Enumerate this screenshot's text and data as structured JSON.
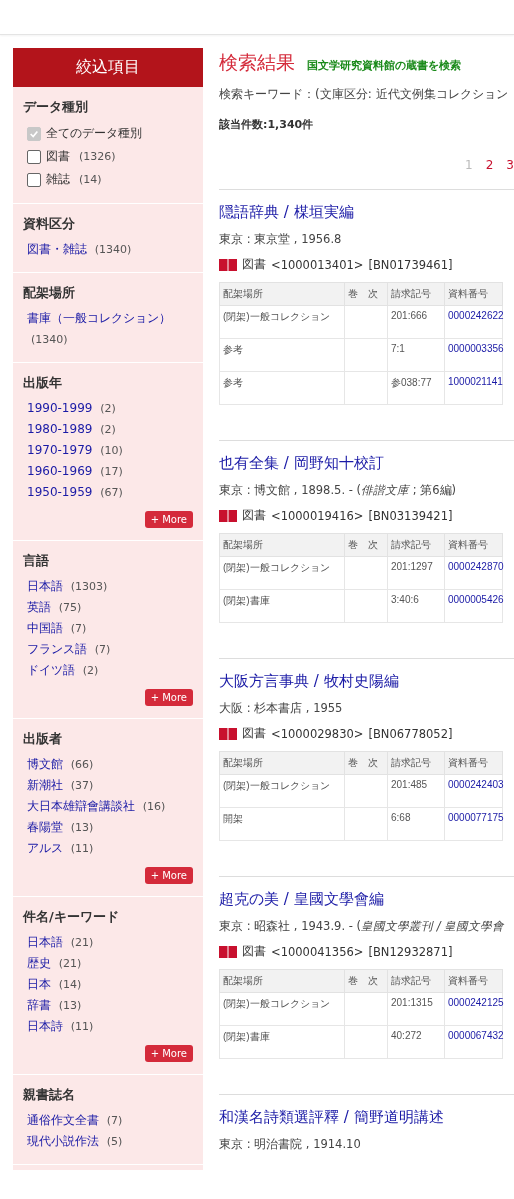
{
  "sidebar": {
    "title": "絞込項目",
    "sections": [
      {
        "kind": "checkboxes",
        "heading": "データ種別",
        "items": [
          {
            "label": "全てのデータ種別",
            "checked": true,
            "disabled": true
          },
          {
            "label": "図書",
            "count": "(1326)",
            "checked": false,
            "disabled": false
          },
          {
            "label": "雑誌",
            "count": "(14)",
            "checked": false,
            "disabled": false
          }
        ]
      },
      {
        "kind": "links",
        "heading": "資料区分",
        "items": [
          {
            "label": "図書・雑誌",
            "count": "(1340)"
          }
        ]
      },
      {
        "kind": "links",
        "heading": "配架場所",
        "items": [
          {
            "label": "書庫（一般コレクション）",
            "count": "(1340)"
          }
        ]
      },
      {
        "kind": "links",
        "heading": "出版年",
        "items": [
          {
            "label": "1990-1999",
            "count": "(2)"
          },
          {
            "label": "1980-1989",
            "count": "(2)"
          },
          {
            "label": "1970-1979",
            "count": "(10)"
          },
          {
            "label": "1960-1969",
            "count": "(17)"
          },
          {
            "label": "1950-1959",
            "count": "(67)"
          }
        ],
        "more": "+ More"
      },
      {
        "kind": "links",
        "heading": "言語",
        "items": [
          {
            "label": "日本語",
            "count": "(1303)"
          },
          {
            "label": "英語",
            "count": "(75)"
          },
          {
            "label": "中国語",
            "count": "(7)"
          },
          {
            "label": "フランス語",
            "count": "(7)"
          },
          {
            "label": "ドイツ語",
            "count": "(2)"
          }
        ],
        "more": "+ More"
      },
      {
        "kind": "links",
        "heading": "出版者",
        "items": [
          {
            "label": "博文館",
            "count": "(66)"
          },
          {
            "label": "新潮社",
            "count": "(37)"
          },
          {
            "label": "大日本雄辯會講談社",
            "count": "(16)"
          },
          {
            "label": "春陽堂",
            "count": "(13)"
          },
          {
            "label": "アルス",
            "count": "(11)"
          }
        ],
        "more": "+ More"
      },
      {
        "kind": "links",
        "heading": "件名/キーワード",
        "items": [
          {
            "label": "日本語",
            "count": "(21)"
          },
          {
            "label": "歴史",
            "count": "(21)"
          },
          {
            "label": "日本",
            "count": "(14)"
          },
          {
            "label": "辞書",
            "count": "(13)"
          },
          {
            "label": "日本詩",
            "count": "(11)"
          }
        ],
        "more": "+ More"
      },
      {
        "kind": "links",
        "heading": "親書誌名",
        "items": [
          {
            "label": "通俗作文全書",
            "count": "(7)"
          },
          {
            "label": "現代小説作法",
            "count": "(5)"
          }
        ]
      }
    ]
  },
  "main": {
    "title": "検索結果",
    "subtitle": "国文学研究資料館の蔵書を検索",
    "keyword": "検索キーワード：(文庫区分: 近代文例集コレクション",
    "hits": "該当件数:1,340件",
    "pages": [
      {
        "label": "1",
        "selected": true
      },
      {
        "label": "2",
        "selected": false
      },
      {
        "label": "3",
        "selected": false
      }
    ],
    "records": [
      {
        "title": "隠語辞典 / 楳垣実編",
        "imprint": "東京 : 東京堂 , 1956.8",
        "type": "図書",
        "id": "<1000013401>",
        "bn": "[BN01739461]",
        "columns": [
          "配架場所",
          "巻　次",
          "請求記号",
          "資料番号"
        ],
        "holdings": [
          {
            "location": "(閉架)一般コレクション",
            "call": "201:666",
            "number": "0000242622"
          },
          {
            "location": "参考",
            "call": "7:1",
            "number": "0000003356"
          },
          {
            "location": "参考",
            "call": "参038:77",
            "number": "1000021141"
          }
        ]
      },
      {
        "title": "也有全集 / 岡野知十校訂",
        "imprint": "東京 : 博文館 , 1898.5. - (*俳諧文庫* ; 第6編)",
        "type": "図書",
        "id": "<1000019416>",
        "bn": "[BN03139421]",
        "columns": [
          "配架場所",
          "巻　次",
          "請求記号",
          "資料番号"
        ],
        "holdings": [
          {
            "location": "(閉架)一般コレクション",
            "call": "201:1297",
            "number": "0000242870"
          },
          {
            "location": "(閉架)書庫",
            "call": "3:40:6",
            "number": "0000005426"
          }
        ]
      },
      {
        "title": "大阪方言事典 / 牧村史陽編",
        "imprint": "大阪 : 杉本書店 , 1955",
        "type": "図書",
        "id": "<1000029830>",
        "bn": "[BN06778052]",
        "columns": [
          "配架場所",
          "巻　次",
          "請求記号",
          "資料番号"
        ],
        "holdings": [
          {
            "location": "(閉架)一般コレクション",
            "call": "201:485",
            "number": "0000242403"
          },
          {
            "location": "開架",
            "call": "6:68",
            "number": "0000077175"
          }
        ]
      },
      {
        "title": "超克の美 / 皇國文學會編",
        "imprint": "東京 : 昭森社 , 1943.9. - (*皇國文學叢刊 / 皇國文學會*",
        "type": "図書",
        "id": "<1000041356>",
        "bn": "[BN12932871]",
        "columns": [
          "配架場所",
          "巻　次",
          "請求記号",
          "資料番号"
        ],
        "holdings": [
          {
            "location": "(閉架)一般コレクション",
            "call": "201:1315",
            "number": "0000242125"
          },
          {
            "location": "(閉架)書庫",
            "call": "40:272",
            "number": "0000067432"
          }
        ]
      },
      {
        "title": "和漢名詩類選評釋 / 簡野道明講述",
        "imprint": "東京 : 明治書院 , 1914.10"
      }
    ]
  }
}
